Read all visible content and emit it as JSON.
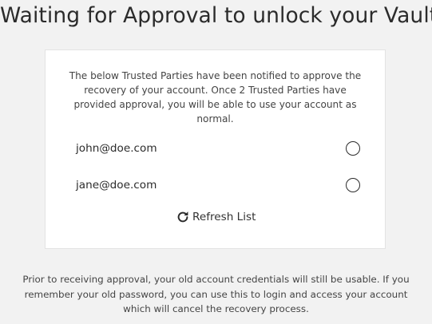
{
  "page": {
    "title": "Waiting for Approval to unlock your Vault"
  },
  "card": {
    "intro": "The below Trusted Parties have been notified to approve the recovery of your account. Once 2 Trusted Parties have provided approval, you will be able to use your account as normal.",
    "trusted_parties": [
      {
        "email": "john@doe.com",
        "approved": false
      },
      {
        "email": "jane@doe.com",
        "approved": false
      }
    ],
    "refresh_label": "Refresh List"
  },
  "footer": {
    "note": "Prior to receiving approval, your old account credentials will still be usable. If you remember your old password, you can use this to login and access your account which will cancel the recovery process."
  },
  "icons": {
    "refresh": "refresh-icon",
    "status": "empty-circle-icon"
  }
}
